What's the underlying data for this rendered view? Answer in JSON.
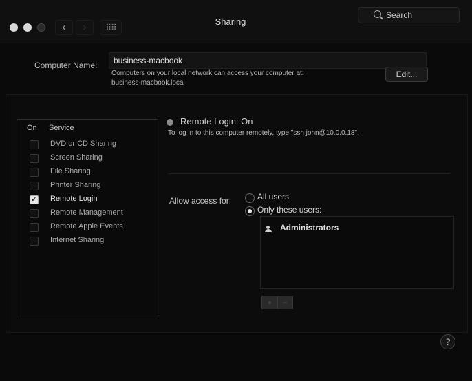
{
  "window": {
    "title": "Sharing"
  },
  "toolbar": {
    "back_glyph": "‹",
    "forward_glyph": "›",
    "grid_glyph": "⠿⠿",
    "search_placeholder": "Search"
  },
  "computer_name": {
    "label": "Computer Name:",
    "value": "business-macbook",
    "description_line1": "Computers on your local network can access your computer at:",
    "description_line2": "business-macbook.local",
    "edit_label": "Edit..."
  },
  "services": {
    "header_on": "On",
    "header_service": "Service",
    "items": [
      {
        "label": "DVD or CD Sharing",
        "checked": false
      },
      {
        "label": "Screen Sharing",
        "checked": false
      },
      {
        "label": "File Sharing",
        "checked": false
      },
      {
        "label": "Printer Sharing",
        "checked": false
      },
      {
        "label": "Remote Login",
        "checked": true
      },
      {
        "label": "Remote Management",
        "checked": false
      },
      {
        "label": "Remote Apple Events",
        "checked": false
      },
      {
        "label": "Internet Sharing",
        "checked": false
      }
    ]
  },
  "detail": {
    "status_label": "Remote Login: On",
    "help_text": "To log in to this computer remotely, type \"ssh john@10.0.0.18\".",
    "allow_access_label": "Allow access for:",
    "option_all": "All users",
    "option_only": "Only these users:",
    "users": [
      {
        "label": "Administrators"
      }
    ],
    "add_glyph": "+",
    "remove_glyph": "−"
  },
  "help_glyph": "?"
}
